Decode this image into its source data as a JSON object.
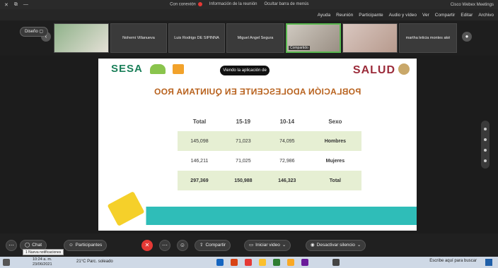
{
  "titlebar": {
    "app": "Cisco Webex Meetings",
    "info": "Información de la reunión",
    "hide_bar": "Ocultar barra de menús",
    "connected": "Con conexión"
  },
  "menu": [
    "Archivo",
    "Editar",
    "Compartir",
    "Ver",
    "Audio y vídeo",
    "Participante",
    "Reunión",
    "Ayuda"
  ],
  "strip": {
    "diseno": "Diseño",
    "participants": [
      "Nohemi Villanueva",
      "Luis Rodrigo DE SIPINNA",
      "Miguel Angel Segura",
      "martha leticia montes aké"
    ],
    "video_label": "Compartido"
  },
  "slide": {
    "share_notice": "Viendo la aplicación de vaio...",
    "logo_left": "SESA",
    "logo_right": "SALUD",
    "title": "POBLACIÓN ADOLESCENTE EN QUINTANA ROO",
    "headers": [
      "Sexo",
      "10-14",
      "15-19",
      "Total"
    ],
    "rows": [
      {
        "label": "Hombres",
        "v1": "74,095",
        "v2": "71,023",
        "total": "145,098"
      },
      {
        "label": "Mujeres",
        "v1": "72,986",
        "v2": "71,025",
        "total": "146,211"
      },
      {
        "label": "Total",
        "v1": "146,323",
        "v2": "150,988",
        "total": "297,369"
      }
    ]
  },
  "controls": {
    "mute": "Desactivar silencio",
    "video": "Iniciar video",
    "share": "Compartir",
    "participants": "Participantes",
    "chat": "Chat",
    "notification": "1 Nueva notificaciones"
  },
  "taskbar": {
    "search": "Escribe aquí para buscar",
    "weather": "21°C Parc. soleado",
    "time": "10:24 a. m.",
    "date": "23/06/2021"
  },
  "colors": {
    "accent_green": "#59b84f",
    "title_orange": "#b8621e",
    "row_shade": "#e6efd3",
    "teal_band": "#2fbdb8",
    "end_red": "#e53935"
  }
}
